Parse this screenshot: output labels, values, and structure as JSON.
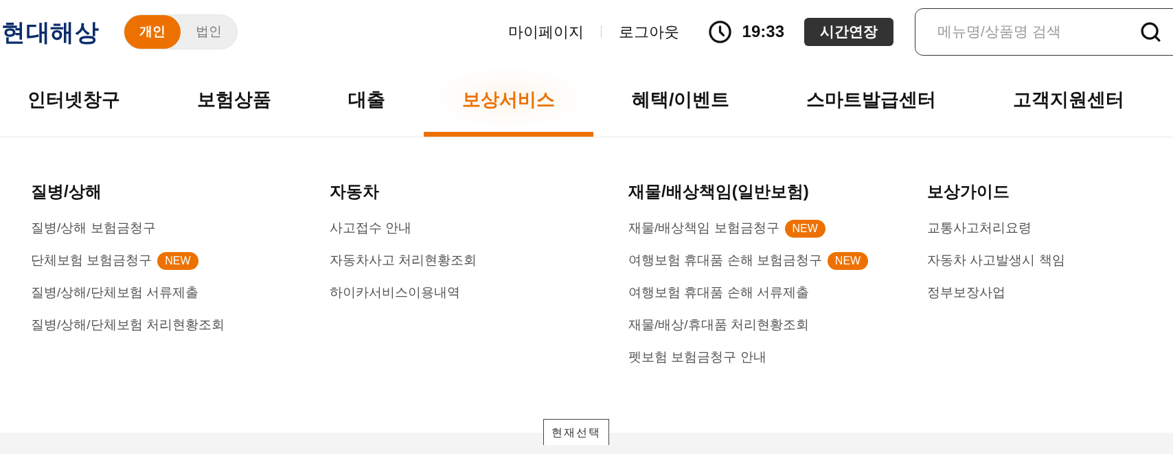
{
  "header": {
    "logo": "현대해상",
    "segments": [
      {
        "label": "개인",
        "selected": true
      },
      {
        "label": "법인",
        "selected": false
      }
    ],
    "links": [
      "마이페이지",
      "로그아웃"
    ],
    "timer": "19:33",
    "extend_button": "시간연장",
    "search": {
      "placeholder": "메뉴명/상품명 검색"
    }
  },
  "nav": [
    {
      "label": "인터넷창구",
      "selected": false
    },
    {
      "label": "보험상품",
      "selected": false
    },
    {
      "label": "대출",
      "selected": false
    },
    {
      "label": "보상서비스",
      "selected": true
    },
    {
      "label": "혜택/이벤트",
      "selected": false
    },
    {
      "label": "스마트발급센터",
      "selected": false
    },
    {
      "label": "고객지원센터",
      "selected": false
    }
  ],
  "menu_columns": [
    {
      "title": "질병/상해",
      "items": [
        {
          "label": "질병/상해 보험금청구"
        },
        {
          "label": "단체보험 보험금청구",
          "badge": "NEW"
        },
        {
          "label": "질병/상해/단체보험 서류제출"
        },
        {
          "label": "질병/상해/단체보험 처리현황조회"
        }
      ]
    },
    {
      "title": "자동차",
      "items": [
        {
          "label": "사고접수 안내"
        },
        {
          "label": "자동차사고 처리현황조회"
        },
        {
          "label": "하이카서비스이용내역"
        }
      ]
    },
    {
      "title": "재물/배상책임(일반보험)",
      "items": [
        {
          "label": "재물/배상책임 보험금청구",
          "badge": "NEW"
        },
        {
          "label": "여행보험 휴대품 손해 보험금청구",
          "badge": "NEW"
        },
        {
          "label": "여행보험 휴대품 손해 서류제출"
        },
        {
          "label": "재물/배상/휴대품 처리현황조회"
        },
        {
          "label": "펫보험 보험금청구 안내"
        }
      ]
    },
    {
      "title": "보상가이드",
      "items": [
        {
          "label": "교통사고처리요령"
        },
        {
          "label": "자동차 사고발생시 책임"
        },
        {
          "label": "정부보장사업"
        }
      ]
    }
  ],
  "current_selection_label": "현재선택"
}
